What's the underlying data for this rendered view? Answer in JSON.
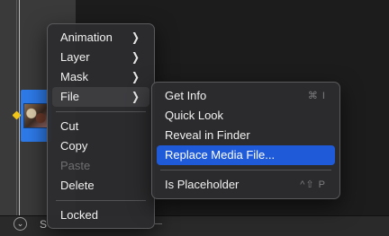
{
  "context_menu": {
    "items": [
      {
        "label": "Animation",
        "submenu": true
      },
      {
        "label": "Layer",
        "submenu": true
      },
      {
        "label": "Mask",
        "submenu": true
      },
      {
        "label": "File",
        "submenu": true,
        "active": true
      },
      {
        "label": "Cut"
      },
      {
        "label": "Copy"
      },
      {
        "label": "Paste",
        "disabled": true
      },
      {
        "label": "Delete"
      },
      {
        "label": "Locked"
      }
    ]
  },
  "file_submenu": {
    "items": [
      {
        "label": "Get Info",
        "shortcut": "⌘ I"
      },
      {
        "label": "Quick Look"
      },
      {
        "label": "Reveal in Finder"
      },
      {
        "label": "Replace Media File...",
        "highlighted": true
      },
      {
        "label": "Is Placeholder",
        "shortcut": "^⇧ P"
      }
    ]
  },
  "bottom_bar": {
    "label": "S"
  },
  "icons": {
    "submenu_arrow": "chevron-right-icon",
    "disclosure": "chevron-down-icon"
  },
  "colors": {
    "highlight": "#1f5bd8",
    "clip": "#2d7ae8",
    "keyframe": "#f0c419"
  }
}
